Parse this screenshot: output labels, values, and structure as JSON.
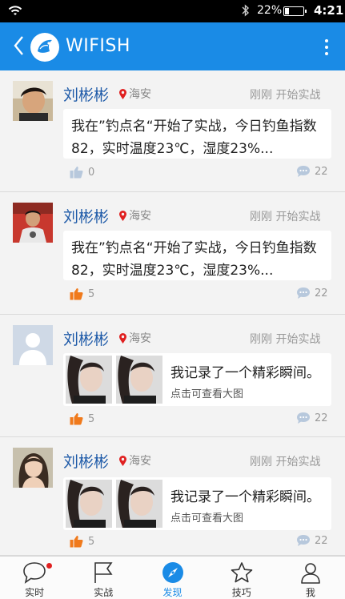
{
  "status_bar": {
    "battery_percent": "22%",
    "battery_level": 0.22,
    "time": "4:21"
  },
  "app_bar": {
    "title": "WIFISH"
  },
  "colors": {
    "primary": "#1a8be6",
    "name": "#1e5aa8",
    "like_active": "#f07a1c",
    "like_inactive": "#b7c8dc",
    "badge": "#e02020"
  },
  "posts": [
    {
      "name": "刘彬彬",
      "location": "海安",
      "meta": "刚刚 开始实战",
      "type": "text",
      "text": "我在”钓点名“开始了实战，今日钓鱼指数82，实时温度23℃，湿度23%...",
      "likes": "0",
      "liked": false,
      "comments": "22"
    },
    {
      "name": "刘彬彬",
      "location": "海安",
      "meta": "刚刚 开始实战",
      "type": "text",
      "text": "我在”钓点名“开始了实战，今日钓鱼指数82，实时温度23℃，湿度23%...",
      "likes": "5",
      "liked": true,
      "comments": "22"
    },
    {
      "name": "刘彬彬",
      "location": "海安",
      "meta": "刚刚 开始实战",
      "type": "media",
      "media_title": "我记录了一个精彩瞬间。",
      "media_sub": "点击可查看大图",
      "likes": "5",
      "liked": true,
      "comments": "22"
    },
    {
      "name": "刘彬彬",
      "location": "海安",
      "meta": "刚刚 开始实战",
      "type": "media",
      "media_title": "我记录了一个精彩瞬间。",
      "media_sub": "点击可查看大图",
      "likes": "5",
      "liked": true,
      "comments": "22"
    }
  ],
  "bottom_nav": [
    {
      "label": "实时",
      "icon": "chat-bubble-icon",
      "badge": true
    },
    {
      "label": "实战",
      "icon": "flag-icon"
    },
    {
      "label": "发现",
      "icon": "compass-icon",
      "active": true
    },
    {
      "label": "技巧",
      "icon": "star-icon"
    },
    {
      "label": "我",
      "icon": "person-icon"
    }
  ]
}
